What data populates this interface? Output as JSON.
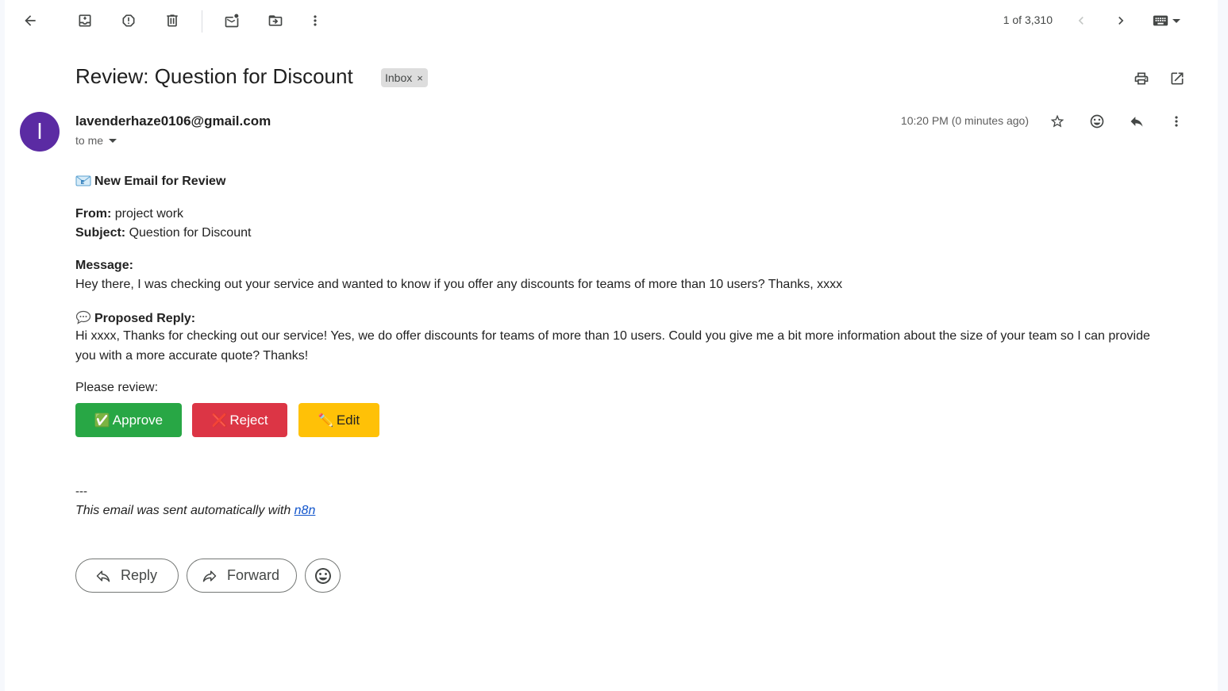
{
  "toolbar": {
    "back_icon": "arrow-back-icon",
    "archive_icon": "archive-icon",
    "spam_icon": "report-spam-icon",
    "delete_icon": "trash-icon",
    "mark_unread_icon": "mark-unread-icon",
    "move_icon": "move-to-folder-icon",
    "more_icon": "more-vert-icon",
    "page_count": "1 of 3,310",
    "prev_icon": "chevron-left-icon",
    "next_icon": "chevron-right-icon",
    "input_tools_icon": "keyboard-icon"
  },
  "email": {
    "subject": "Review: Question for Discount",
    "label": "Inbox",
    "label_close": "×",
    "avatar_letter": "l",
    "avatar_color": "#5b2ba3",
    "sender": "lavenderhaze0106@gmail.com",
    "recipient": "to me",
    "timestamp": "10:20 PM (0 minutes ago)"
  },
  "body": {
    "heading": "New Email for Review",
    "from_label": "From:",
    "from_value": "project work",
    "subject_label": "Subject:",
    "subject_value": "Question for Discount",
    "message_label": "Message:",
    "message_text": "Hey there, I was checking out your service and wanted to know if you offer any discounts for teams of more than 10 users? Thanks, xxxx",
    "proposed_label": "Proposed Reply:",
    "proposed_line1": "Hi xxxx, Thanks for checking out our service! Yes, we do offer discounts for teams of more than 10 users. Could you give me a bit more information about the size of your team so I can provide",
    "proposed_line2": "you with a more accurate quote? Thanks!",
    "review_prompt": "Please review:",
    "approve_label": "Approve",
    "approve_glyph": "✅",
    "approve_color": "#28a745",
    "reject_label": "Reject",
    "reject_glyph": "❌",
    "reject_color": "#dc3545",
    "edit_label": "Edit",
    "edit_glyph": "✏️",
    "edit_color": "#ffc107",
    "separator": "---",
    "footer_text": "This email was sent automatically with ",
    "footer_link": "n8n"
  },
  "actions": {
    "reply_label": "Reply",
    "forward_label": "Forward"
  }
}
